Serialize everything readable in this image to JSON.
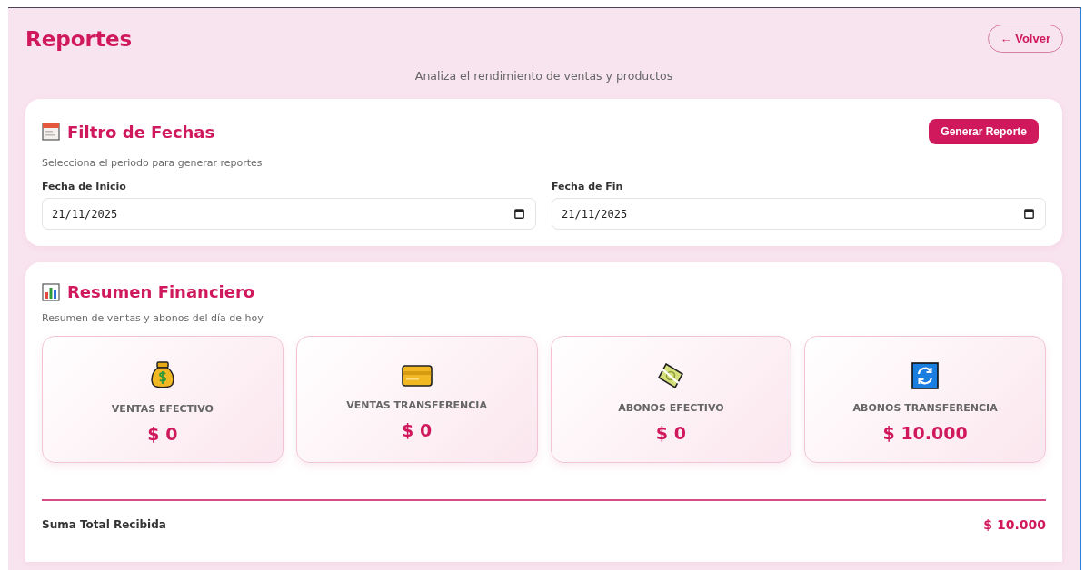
{
  "header": {
    "title": "Reportes",
    "back_button": "← Volver",
    "subtitle": "Analiza el rendimiento de ventas y productos"
  },
  "date_filter": {
    "title": "Filtro de Fechas",
    "description": "Selecciona el periodo para generar reportes",
    "button": "Generar Reporte",
    "fields": [
      {
        "label": "Fecha de Inicio",
        "value": "21/11/2025"
      },
      {
        "label": "Fecha de Fin",
        "value": "21/11/2025"
      }
    ]
  },
  "summary": {
    "title": "Resumen Financiero",
    "description": "Resumen de ventas y abonos del día de hoy",
    "stats": [
      {
        "kind": "bag",
        "label": "VENTAS EFECTIVO",
        "value": "$ 0"
      },
      {
        "kind": "card",
        "label": "VENTAS TRANSFERENCIA",
        "value": "$ 0"
      },
      {
        "kind": "bill",
        "label": "ABONOS EFECTIVO",
        "value": "$ 0"
      },
      {
        "kind": "refresh",
        "label": "ABONOS TRANSFERENCIA",
        "value": "$ 10.000"
      }
    ],
    "total": {
      "label": "Suma Total Recibida",
      "value": "$ 10.000"
    }
  }
}
